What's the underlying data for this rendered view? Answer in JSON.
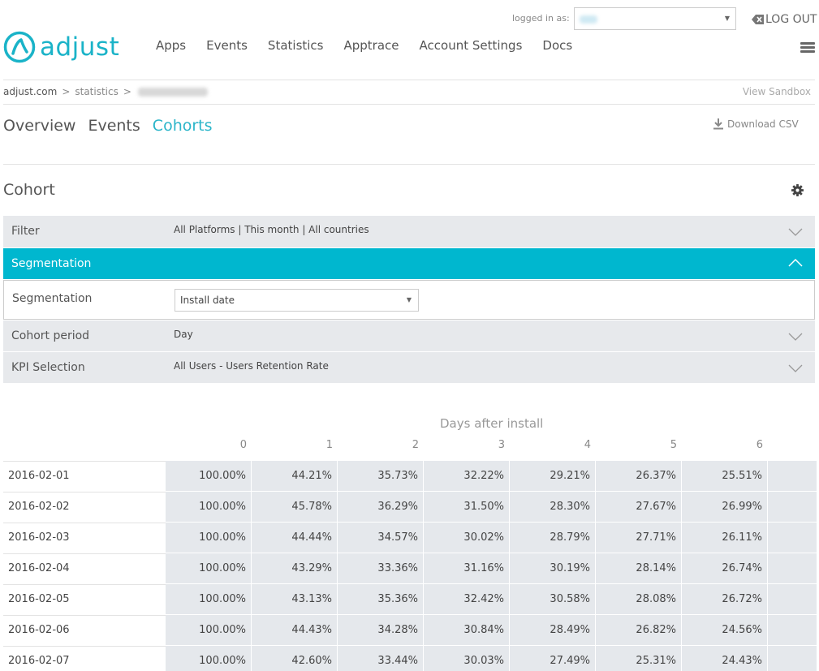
{
  "brand": {
    "name": "adjust",
    "color": "#1ab3c8"
  },
  "nav": {
    "items": [
      "Apps",
      "Events",
      "Statistics",
      "Apptrace",
      "Account Settings",
      "Docs"
    ]
  },
  "account": {
    "logged_in_label": "logged in as:",
    "logout_label": "LOG OUT"
  },
  "breadcrumb": {
    "root": "adjust.com",
    "section": "statistics"
  },
  "view_sandbox": "View Sandbox",
  "tabs": [
    {
      "label": "Overview",
      "active": false
    },
    {
      "label": "Events",
      "active": false
    },
    {
      "label": "Cohorts",
      "active": true
    }
  ],
  "download_csv": "Download CSV",
  "cohort": {
    "title": "Cohort",
    "filter": {
      "label": "Filter",
      "value": "All Platforms | This month | All countries"
    },
    "segmentation_header": "Segmentation",
    "segmentation": {
      "label": "Segmentation",
      "selected": "Install date"
    },
    "period": {
      "label": "Cohort period",
      "value": "Day"
    },
    "kpi": {
      "label": "KPI Selection",
      "value": "All Users - Users Retention Rate"
    }
  },
  "table": {
    "title": "Days after install",
    "columns": [
      "0",
      "1",
      "2",
      "3",
      "4",
      "5",
      "6"
    ],
    "rows": [
      {
        "date": "2016-02-01",
        "values": [
          "100.00%",
          "44.21%",
          "35.73%",
          "32.22%",
          "29.21%",
          "26.37%",
          "25.51%"
        ]
      },
      {
        "date": "2016-02-02",
        "values": [
          "100.00%",
          "45.78%",
          "36.29%",
          "31.50%",
          "28.30%",
          "27.67%",
          "26.99%"
        ]
      },
      {
        "date": "2016-02-03",
        "values": [
          "100.00%",
          "44.44%",
          "34.57%",
          "30.02%",
          "28.79%",
          "27.71%",
          "26.11%"
        ]
      },
      {
        "date": "2016-02-04",
        "values": [
          "100.00%",
          "43.29%",
          "33.36%",
          "31.16%",
          "30.19%",
          "28.14%",
          "26.74%"
        ]
      },
      {
        "date": "2016-02-05",
        "values": [
          "100.00%",
          "43.13%",
          "35.36%",
          "32.42%",
          "30.58%",
          "28.08%",
          "26.72%"
        ]
      },
      {
        "date": "2016-02-06",
        "values": [
          "100.00%",
          "44.43%",
          "34.28%",
          "30.84%",
          "28.49%",
          "26.82%",
          "24.56%"
        ]
      },
      {
        "date": "2016-02-07",
        "values": [
          "100.00%",
          "42.60%",
          "33.44%",
          "30.03%",
          "27.49%",
          "25.31%",
          "24.43%"
        ]
      }
    ]
  }
}
